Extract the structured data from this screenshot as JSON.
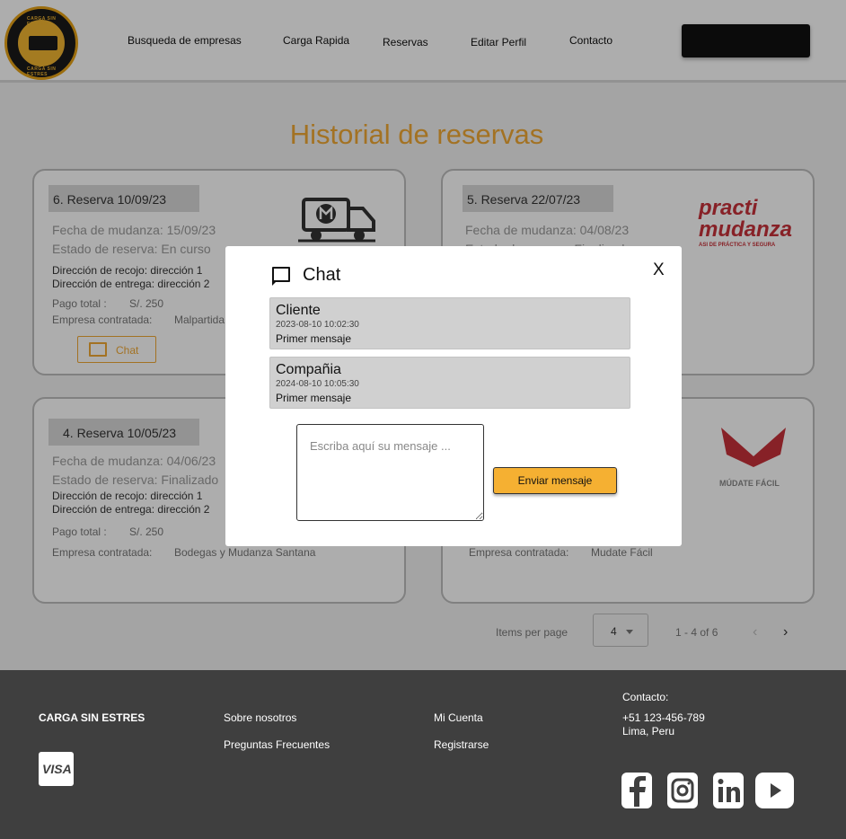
{
  "nav": {
    "logo_text_top": "CARGA SIN ESTRES",
    "logo_text_bottom": "CARGA SIN ESTRES",
    "links": [
      "Busqueda de empresas",
      "Carga Rapida",
      "Reservas",
      "Editar Perfil",
      "Contacto"
    ]
  },
  "page": {
    "title": "Historial de reservas"
  },
  "cards": [
    {
      "tag": "6. Reserva 10/09/23",
      "fecha": "Fecha de mudanza: 15/09/23",
      "estado": "Estado de reserva: En curso",
      "recojo": "Dirección de recojo: dirección 1",
      "entrega": "Dirección de entrega: dirección 2",
      "pago_label": "Pago total :",
      "pago_val": "S/. 250",
      "empresa_label": "Empresa contratada:",
      "empresa_val": "Malpartida",
      "chat_label": "Chat",
      "logo_icon": "truck-logo-icon"
    },
    {
      "tag": "5. Reserva 22/07/23",
      "fecha": "Fecha de mudanza: 04/08/23",
      "estado": "Estado de reserva: Finalizado",
      "logo_line1": "practi",
      "logo_line2": "mudanza",
      "logo_sub": "ASI DE PRÁCTICA Y SEGURA",
      "logo_icon": "practi-mudanza-logo-icon"
    },
    {
      "tag": "4. Reserva 10/05/23",
      "fecha": "Fecha de mudanza: 04/06/23",
      "estado": "Estado de reserva: Finalizado",
      "recojo": "Dirección de recojo: dirección 1",
      "entrega": "Dirección de entrega: dirección 2",
      "pago_label": "Pago total :",
      "pago_val": "S/. 250",
      "empresa_label": "Empresa contratada:",
      "empresa_val": "Bodegas y Mudanza Santana"
    },
    {
      "empresa_label": "Empresa contratada:",
      "empresa_val": "Mudate Fácil",
      "logo_text": "MÚDATE FÁCIL",
      "logo_icon": "mudate-facil-logo-icon"
    }
  ],
  "pager": {
    "items_label": "Items per page",
    "page_size": "4",
    "range": "1 - 4 of 6"
  },
  "chat": {
    "title": "Chat",
    "close": "X",
    "messages": [
      {
        "author": "Cliente",
        "time": "2023-08-10 10:02:30",
        "text": "Primer mensaje"
      },
      {
        "author": "Compañia",
        "time": "2024-08-10 10:05:30",
        "text": "Primer mensaje"
      }
    ],
    "input_placeholder": "Escriba aquí su mensaje ...",
    "send_label": "Enviar mensaje"
  },
  "footer": {
    "brand": "CARGA SIN ESTRES",
    "links_col1": [
      "Sobre nosotros",
      "Preguntas Frecuentes"
    ],
    "links_col2": [
      "Mi Cuenta",
      "Registrarse"
    ],
    "contact_label": "Contacto:",
    "phone": "+51 123-456-789",
    "city": "Lima, Peru",
    "visa": "VISA",
    "socials": [
      "facebook-icon",
      "instagram-icon",
      "linkedin-icon",
      "youtube-icon"
    ]
  }
}
